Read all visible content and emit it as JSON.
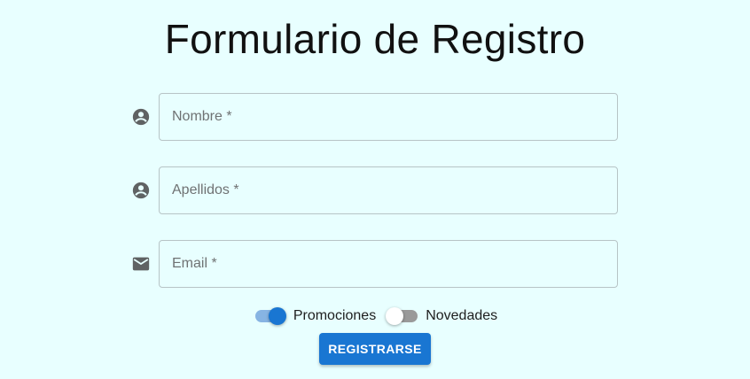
{
  "page": {
    "title": "Formulario de Registro"
  },
  "form": {
    "fields": [
      {
        "label": "Nombre *",
        "value": "",
        "icon": "account-circle-icon"
      },
      {
        "label": "Apellidos *",
        "value": "",
        "icon": "account-circle-icon"
      },
      {
        "label": "Email *",
        "value": "",
        "icon": "email-icon"
      }
    ],
    "switches": [
      {
        "label": "Promociones",
        "checked": true
      },
      {
        "label": "Novedades",
        "checked": false
      }
    ],
    "submit_label": "REGISTRARSE"
  },
  "colors": {
    "background": "#e8ffff",
    "accent": "#1976d2",
    "icon": "#5f6263",
    "border": "#b7c4c6"
  }
}
